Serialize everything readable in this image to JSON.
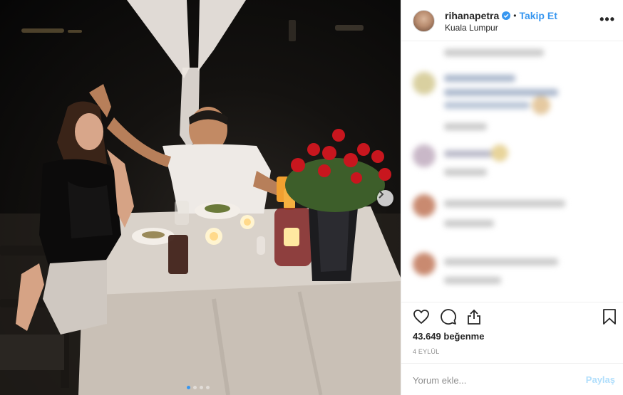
{
  "post": {
    "username": "rihanapetra",
    "follow_separator": "•",
    "follow_label": "Takip Et",
    "location": "Kuala Lumpur",
    "more_label": "•••",
    "likes_count": "43.649",
    "likes_label": "beğenme",
    "date": "4 EYLÜL",
    "comment_placeholder": "Yorum ekle...",
    "post_label": "Paylaş"
  },
  "carousel": {
    "slide_count": 4,
    "active_index": 0
  },
  "colors": {
    "accent": "#3897f0",
    "text": "#262626",
    "muted": "#8e8e8e",
    "post_disabled": "#b2dffc"
  },
  "icons": {
    "verified": "verified-badge-icon",
    "like": "heart-icon",
    "comment": "speech-bubble-icon",
    "share": "share-icon",
    "save": "bookmark-icon",
    "next": "chevron-right-icon"
  }
}
